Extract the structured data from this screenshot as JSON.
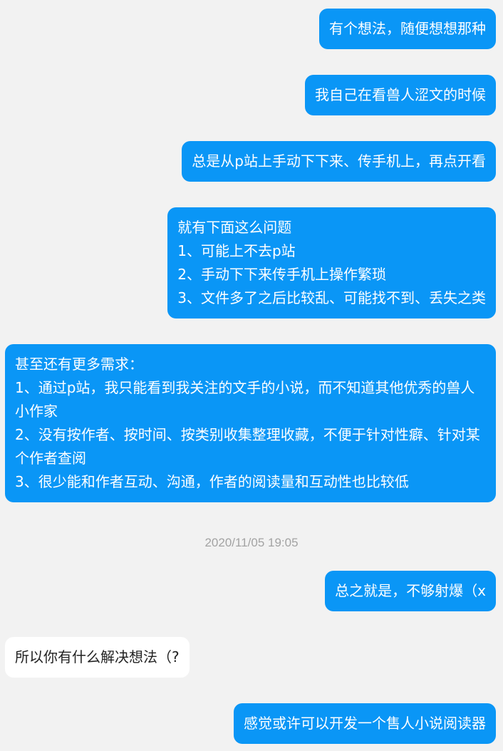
{
  "colors": {
    "background": "#f2f2f2",
    "outgoing_bubble": "#0a96f6",
    "incoming_bubble": "#ffffff",
    "timestamp_text": "#a3a3a3"
  },
  "messages": [
    {
      "sender": "me",
      "lines": [
        "有个想法，随便想想那种"
      ]
    },
    {
      "sender": "me",
      "lines": [
        "我自己在看兽人涩文的时候"
      ]
    },
    {
      "sender": "me",
      "lines": [
        "总是从p站上手动下下来、传手机上，再点开看"
      ]
    },
    {
      "sender": "me",
      "lines": [
        "就有下面这么问题",
        "1、可能上不去p站",
        "2、手动下下来传手机上操作繁琐",
        "3、文件多了之后比较乱、可能找不到、丢失之类"
      ]
    },
    {
      "sender": "me",
      "lines": [
        "甚至还有更多需求：",
        "1、通过p站，我只能看到我关注的文手的小说，而不知道其他优秀的兽人小作家",
        "2、没有按作者、按时间、按类别收集整理收藏，不便于针对性癖、针对某个作者查阅",
        "3、很少能和作者互动、沟通，作者的阅读量和互动性也比较低"
      ]
    },
    {
      "sender": "me",
      "lines": [
        "总之就是，不够射爆（x"
      ]
    },
    {
      "sender": "other",
      "lines": [
        "所以你有什么解决想法（?"
      ]
    },
    {
      "sender": "me",
      "lines": [
        "感觉或许可以开发一个售人小说阅读器"
      ]
    }
  ],
  "timestamp": "2020/11/05 19:05"
}
